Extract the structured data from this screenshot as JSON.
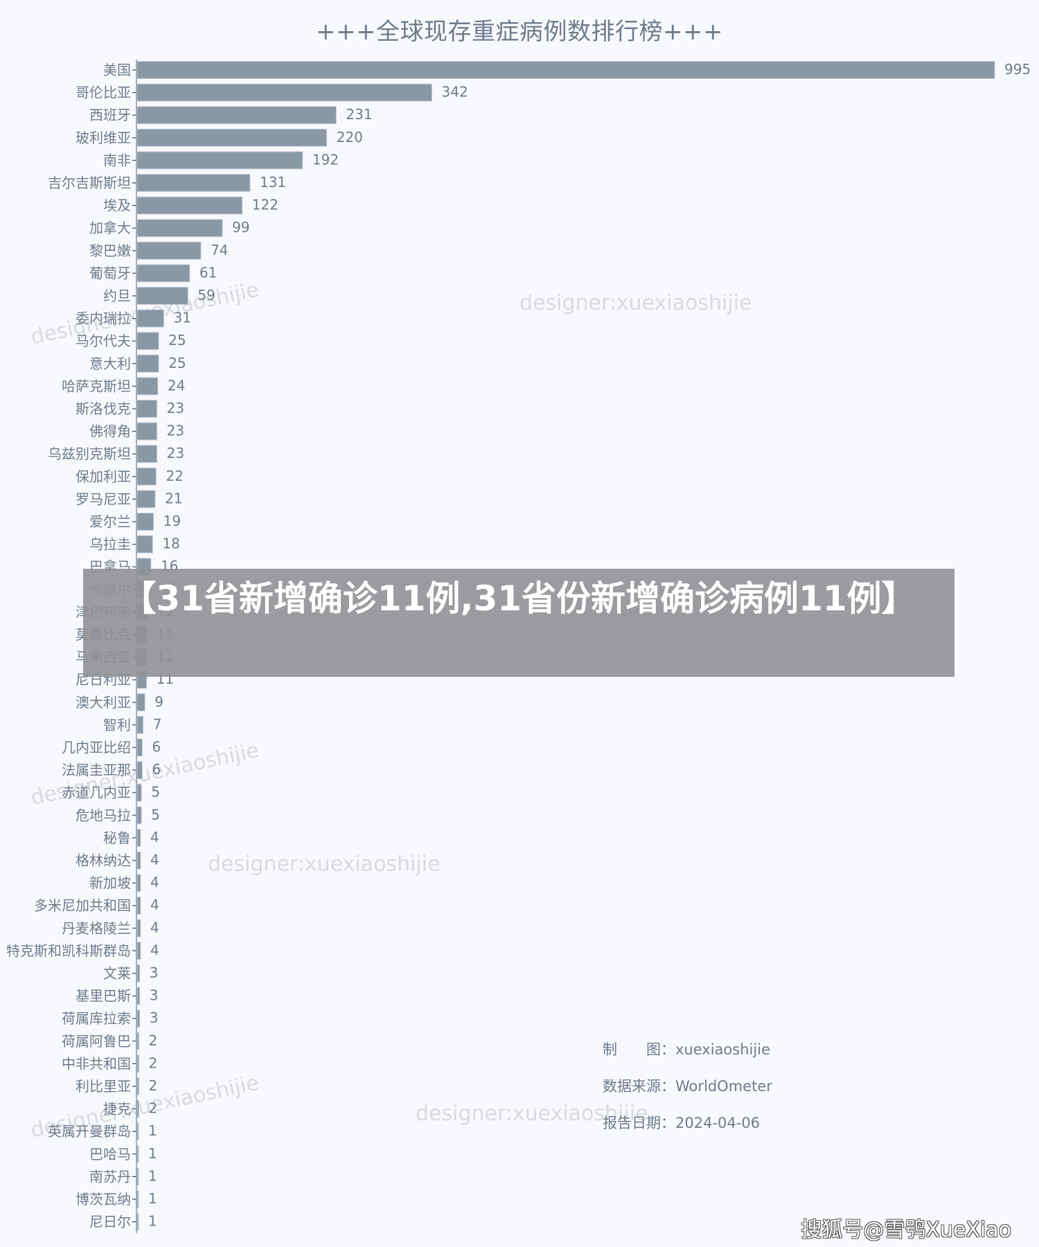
{
  "chart_data": {
    "type": "bar",
    "orientation": "horizontal",
    "title": "+++全球现存重症病例数排行榜+++",
    "xlabel": "",
    "ylabel": "",
    "xlim": [
      0,
      995
    ],
    "grid": false,
    "bar_color": "#8a98a6",
    "categories": [
      "美国",
      "哥伦比亚",
      "西班牙",
      "玻利维亚",
      "南非",
      "吉尔吉斯斯坦",
      "埃及",
      "加拿大",
      "黎巴嫩",
      "葡萄牙",
      "约旦",
      "委内瑞拉",
      "马尔代夫",
      "意大利",
      "哈萨克斯坦",
      "斯洛伐克",
      "佛得角",
      "乌兹别克斯坦",
      "保加利亚",
      "罗马尼亚",
      "爱尔兰",
      "乌拉圭",
      "巴拿马",
      "卡塔尔",
      "津巴布韦",
      "莫桑比克",
      "马来西亚",
      "尼日利亚",
      "澳大利亚",
      "智利",
      "几内亚比绍",
      "法属圭亚那",
      "赤道几内亚",
      "危地马拉",
      "秘鲁",
      "格林纳达",
      "新加坡",
      "多米尼加共和国",
      "丹麦格陵兰",
      "特克斯和凯科斯群岛",
      "文莱",
      "基里巴斯",
      "荷属库拉索",
      "荷属阿鲁巴",
      "中非共和国",
      "利比里亚",
      "捷克",
      "英属开曼群岛",
      "巴哈马",
      "南苏丹",
      "博茨瓦纳",
      "尼日尔"
    ],
    "values": [
      995,
      342,
      231,
      220,
      192,
      131,
      122,
      99,
      74,
      61,
      59,
      31,
      25,
      25,
      24,
      23,
      23,
      23,
      22,
      21,
      19,
      18,
      16,
      16,
      12,
      11,
      11,
      11,
      9,
      7,
      6,
      6,
      5,
      5,
      4,
      4,
      4,
      4,
      4,
      4,
      3,
      3,
      3,
      2,
      2,
      2,
      2,
      1,
      1,
      1,
      1,
      1
    ]
  },
  "info": {
    "maker_label": "制　　图：",
    "maker_value": "xuexiaoshijie",
    "source_label": "数据来源：",
    "source_value": "WorldOmeter",
    "date_label": "报告日期：",
    "date_value": "2024-04-06"
  },
  "watermarks": {
    "text": "designer:xuexiaoshijie"
  },
  "overlay": {
    "headline": "【31省新增确诊11例,31省份新增确诊病例11例】"
  },
  "source_mark": "搜狐号@雪鸮XueXiao"
}
